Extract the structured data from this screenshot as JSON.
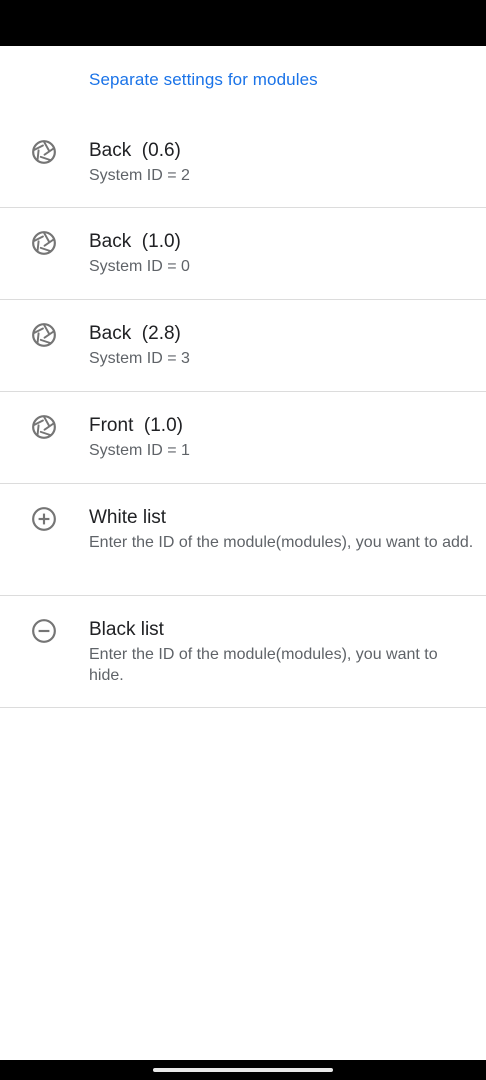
{
  "header": {
    "title": "Separate settings for modules"
  },
  "items": [
    {
      "title": "Back  (0.6)",
      "summary": "System ID = 2",
      "icon": "shutter-icon"
    },
    {
      "title": "Back  (1.0)",
      "summary": "System ID = 0",
      "icon": "shutter-icon"
    },
    {
      "title": "Back  (2.8)",
      "summary": "System ID = 3",
      "icon": "shutter-icon"
    },
    {
      "title": "Front  (1.0)",
      "summary": "System ID = 1",
      "icon": "shutter-icon"
    },
    {
      "title": "White list",
      "summary": "Enter the ID of the module(modules), you want to add.",
      "icon": "add-circle-icon"
    },
    {
      "title": "Black list",
      "summary": "Enter the ID of the module(modules), you want to hide.",
      "icon": "remove-circle-icon"
    }
  ],
  "colors": {
    "accent": "#1a73e8",
    "title": "#202124",
    "summary": "#5f6368",
    "icon": "#757575",
    "divider": "#dcdcdc"
  }
}
